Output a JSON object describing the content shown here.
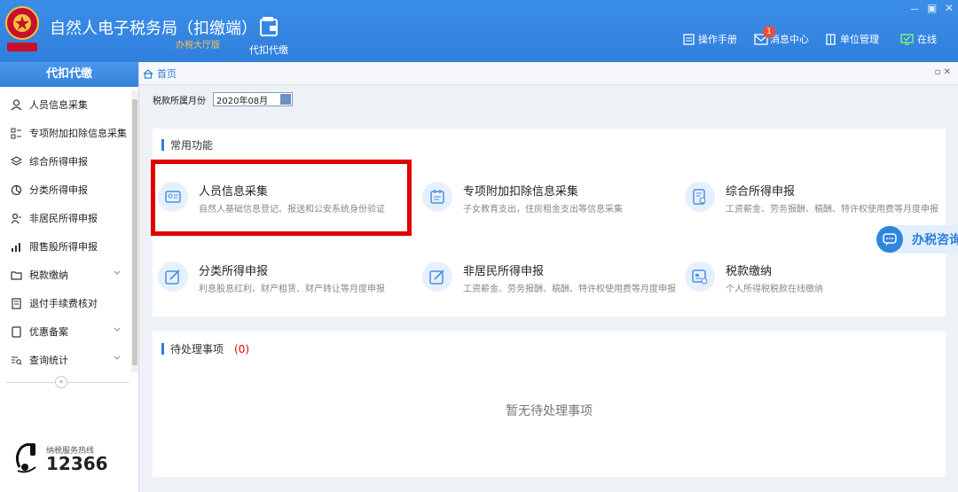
{
  "header": {
    "title": "自然人电子税务局（扣缴端）",
    "subtitle": "办税大厅版",
    "module_label": "代扣代缴",
    "window_controls": [
      "－",
      "▣",
      "✕"
    ],
    "links": [
      {
        "label": "操作手册",
        "icon": "book-icon"
      },
      {
        "label": "消息中心",
        "icon": "mail-icon",
        "badge": "1"
      },
      {
        "label": "单位管理",
        "icon": "building-icon"
      },
      {
        "label": "在线",
        "icon": "online-monitor-icon"
      }
    ],
    "colors": {
      "bar": "#2f7fdc",
      "subtitle": "#f5c24a",
      "badge": "#e94f35"
    }
  },
  "sidebar": {
    "heading": "代扣代缴",
    "items": [
      {
        "label": "人员信息采集",
        "icon": "person-icon",
        "expandable": false
      },
      {
        "label": "专项附加扣除信息采集",
        "icon": "list-icon",
        "expandable": false
      },
      {
        "label": "综合所得申报",
        "icon": "layers-icon",
        "expandable": false
      },
      {
        "label": "分类所得申报",
        "icon": "pie-icon",
        "expandable": false
      },
      {
        "label": "非居民所得申报",
        "icon": "person-outline-icon",
        "expandable": false
      },
      {
        "label": "限售股所得申报",
        "icon": "bar-chart-icon",
        "expandable": false
      },
      {
        "label": "税款缴纳",
        "icon": "folder-icon",
        "expandable": true
      },
      {
        "label": "退付手续费核对",
        "icon": "receipt-icon",
        "expandable": false
      },
      {
        "label": "优惠备案",
        "icon": "document-icon",
        "expandable": true
      },
      {
        "label": "查询统计",
        "icon": "search-list-icon",
        "expandable": true
      }
    ],
    "collapse_glyph": "«",
    "hotline_label": "纳税服务热线",
    "hotline_number": "12366"
  },
  "tabs": {
    "home_label": "首页",
    "tools": "▫ ✕"
  },
  "period": {
    "label": "税款所属月份",
    "value": "2020年08月"
  },
  "common": {
    "title": "常用功能",
    "cards": [
      {
        "title": "人员信息采集",
        "desc": "自然人基础信息登记、报送和公安系统身份验证",
        "icon": "id-card-icon"
      },
      {
        "title": "专项附加扣除信息采集",
        "desc": "子女教育支出，住房租金支出等信息采集",
        "icon": "calendar-icon"
      },
      {
        "title": "综合所得申报",
        "desc": "工资薪金、劳务报酬、稿酬、特许权使用费等月度申报",
        "icon": "form-icon"
      },
      {
        "title": "分类所得申报",
        "desc": "利息股息红利、财产租赁、财产转让等月度申报",
        "icon": "edit-icon"
      },
      {
        "title": "非居民所得申报",
        "desc": "工资薪金、劳务报酬、稿酬、特许权使用费等月度申报",
        "icon": "edit-icon"
      },
      {
        "title": "税款缴纳",
        "desc": "个人所得税税款在线缴纳",
        "icon": "payment-icon"
      }
    ],
    "highlight_color": "#e00000"
  },
  "consult": {
    "label": "办税咨询",
    "icon": "chat-icon"
  },
  "pending": {
    "title": "待处理事项",
    "count": "(0)",
    "empty": "暂无待处理事项"
  }
}
